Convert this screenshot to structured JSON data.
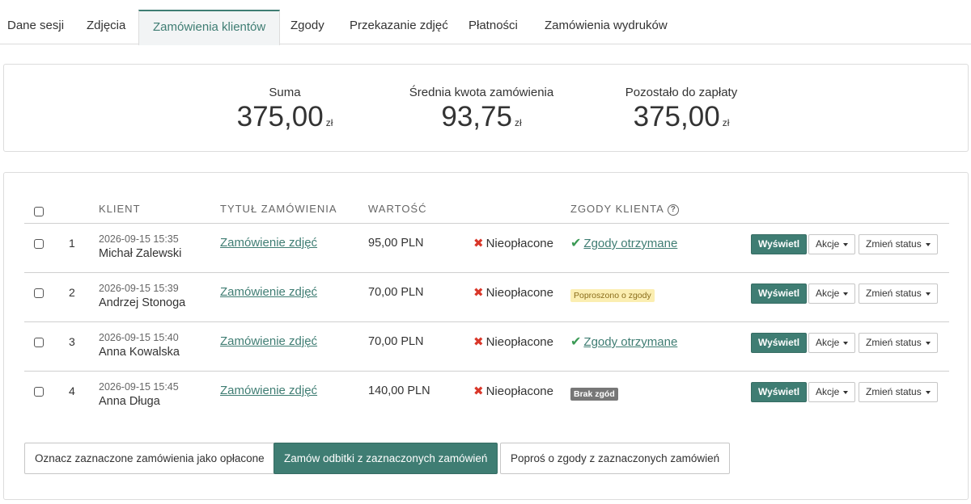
{
  "tabs": [
    {
      "label": "Dane sesji"
    },
    {
      "label": "Zdjęcia"
    },
    {
      "label": "Zamówienia klientów"
    },
    {
      "label": "Zgody"
    },
    {
      "label": "Przekazanie zdjęć"
    },
    {
      "label": "Płatności"
    },
    {
      "label": "Zamówienia wydruków"
    }
  ],
  "active_tab": "Zamówienia klientów",
  "summary": {
    "total": {
      "label": "Suma",
      "value": "375,00",
      "currency": "zł"
    },
    "average": {
      "label": "Średnia kwota zamówienia",
      "value": "93,75",
      "currency": "zł"
    },
    "remaining": {
      "label": "Pozostało do zapłaty",
      "value": "375,00",
      "currency": "zł"
    }
  },
  "table": {
    "headers": {
      "client": "KLIENT",
      "title": "TYTUŁ ZAMÓWIENIA",
      "value": "WARTOŚĆ",
      "consents": "ZGODY KLIENTA",
      "help_icon": "?"
    },
    "rows": [
      {
        "num": "1",
        "date": "2026-09-15 15:35",
        "client": "Michał Zalewski",
        "title": "Zamówienie zdjęć",
        "value": "95,00 PLN",
        "payment_status": "Nieopłacone",
        "consent_type": "link",
        "consent": "Zgody otrzymane",
        "view_label": "Wyświetl",
        "actions_label": "Akcje",
        "status_label": "Zmień status"
      },
      {
        "num": "2",
        "date": "2026-09-15 15:39",
        "client": "Andrzej Stonoga",
        "title": "Zamówienie zdjęć",
        "value": "70,00 PLN",
        "payment_status": "Nieopłacone",
        "consent_type": "badge-yellow",
        "consent": "Poproszono o zgody",
        "view_label": "Wyświetl",
        "actions_label": "Akcje",
        "status_label": "Zmień status"
      },
      {
        "num": "3",
        "date": "2026-09-15 15:40",
        "client": "Anna Kowalska",
        "title": "Zamówienie zdjęć",
        "value": "70,00 PLN",
        "payment_status": "Nieopłacone",
        "consent_type": "link",
        "consent": "Zgody otrzymane",
        "view_label": "Wyświetl",
        "actions_label": "Akcje",
        "status_label": "Zmień status"
      },
      {
        "num": "4",
        "date": "2026-09-15 15:45",
        "client": "Anna Długa",
        "title": "Zamówienie zdjęć",
        "value": "140,00 PLN",
        "payment_status": "Nieopłacone",
        "consent_type": "badge-gray",
        "consent": "Brak zgód",
        "view_label": "Wyświetl",
        "actions_label": "Akcje",
        "status_label": "Zmień status"
      }
    ]
  },
  "bulk_actions": {
    "mark_paid": "Oznacz zaznaczone zamówienia jako opłacone",
    "order_prints": "Zamów odbitki z zaznaczonych zamówień",
    "request_consents": "Poproś o zgody z zaznaczonych zamówień"
  },
  "colors": {
    "accent": "#3f7d73",
    "unpaid_x": "#d9372a",
    "consent_check": "#3b9a55",
    "badge_yellow_bg": "#fbeeb1",
    "badge_gray_bg": "#777777"
  }
}
